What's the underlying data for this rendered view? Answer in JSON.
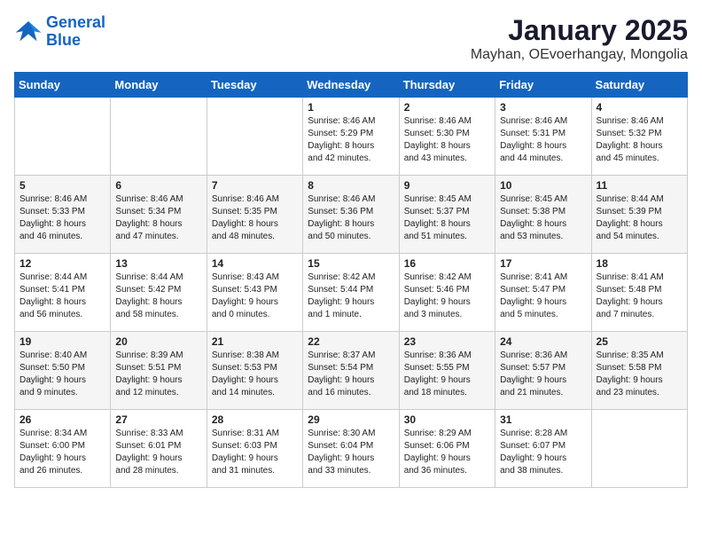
{
  "header": {
    "logo_line1": "General",
    "logo_line2": "Blue",
    "title": "January 2025",
    "subtitle": "Mayhan, OEvoerhangay, Mongolia"
  },
  "weekdays": [
    "Sunday",
    "Monday",
    "Tuesday",
    "Wednesday",
    "Thursday",
    "Friday",
    "Saturday"
  ],
  "weeks": [
    [
      {
        "day": "",
        "text": ""
      },
      {
        "day": "",
        "text": ""
      },
      {
        "day": "",
        "text": ""
      },
      {
        "day": "1",
        "text": "Sunrise: 8:46 AM\nSunset: 5:29 PM\nDaylight: 8 hours\nand 42 minutes."
      },
      {
        "day": "2",
        "text": "Sunrise: 8:46 AM\nSunset: 5:30 PM\nDaylight: 8 hours\nand 43 minutes."
      },
      {
        "day": "3",
        "text": "Sunrise: 8:46 AM\nSunset: 5:31 PM\nDaylight: 8 hours\nand 44 minutes."
      },
      {
        "day": "4",
        "text": "Sunrise: 8:46 AM\nSunset: 5:32 PM\nDaylight: 8 hours\nand 45 minutes."
      }
    ],
    [
      {
        "day": "5",
        "text": "Sunrise: 8:46 AM\nSunset: 5:33 PM\nDaylight: 8 hours\nand 46 minutes."
      },
      {
        "day": "6",
        "text": "Sunrise: 8:46 AM\nSunset: 5:34 PM\nDaylight: 8 hours\nand 47 minutes."
      },
      {
        "day": "7",
        "text": "Sunrise: 8:46 AM\nSunset: 5:35 PM\nDaylight: 8 hours\nand 48 minutes."
      },
      {
        "day": "8",
        "text": "Sunrise: 8:46 AM\nSunset: 5:36 PM\nDaylight: 8 hours\nand 50 minutes."
      },
      {
        "day": "9",
        "text": "Sunrise: 8:45 AM\nSunset: 5:37 PM\nDaylight: 8 hours\nand 51 minutes."
      },
      {
        "day": "10",
        "text": "Sunrise: 8:45 AM\nSunset: 5:38 PM\nDaylight: 8 hours\nand 53 minutes."
      },
      {
        "day": "11",
        "text": "Sunrise: 8:44 AM\nSunset: 5:39 PM\nDaylight: 8 hours\nand 54 minutes."
      }
    ],
    [
      {
        "day": "12",
        "text": "Sunrise: 8:44 AM\nSunset: 5:41 PM\nDaylight: 8 hours\nand 56 minutes."
      },
      {
        "day": "13",
        "text": "Sunrise: 8:44 AM\nSunset: 5:42 PM\nDaylight: 8 hours\nand 58 minutes."
      },
      {
        "day": "14",
        "text": "Sunrise: 8:43 AM\nSunset: 5:43 PM\nDaylight: 9 hours\nand 0 minutes."
      },
      {
        "day": "15",
        "text": "Sunrise: 8:42 AM\nSunset: 5:44 PM\nDaylight: 9 hours\nand 1 minute."
      },
      {
        "day": "16",
        "text": "Sunrise: 8:42 AM\nSunset: 5:46 PM\nDaylight: 9 hours\nand 3 minutes."
      },
      {
        "day": "17",
        "text": "Sunrise: 8:41 AM\nSunset: 5:47 PM\nDaylight: 9 hours\nand 5 minutes."
      },
      {
        "day": "18",
        "text": "Sunrise: 8:41 AM\nSunset: 5:48 PM\nDaylight: 9 hours\nand 7 minutes."
      }
    ],
    [
      {
        "day": "19",
        "text": "Sunrise: 8:40 AM\nSunset: 5:50 PM\nDaylight: 9 hours\nand 9 minutes."
      },
      {
        "day": "20",
        "text": "Sunrise: 8:39 AM\nSunset: 5:51 PM\nDaylight: 9 hours\nand 12 minutes."
      },
      {
        "day": "21",
        "text": "Sunrise: 8:38 AM\nSunset: 5:53 PM\nDaylight: 9 hours\nand 14 minutes."
      },
      {
        "day": "22",
        "text": "Sunrise: 8:37 AM\nSunset: 5:54 PM\nDaylight: 9 hours\nand 16 minutes."
      },
      {
        "day": "23",
        "text": "Sunrise: 8:36 AM\nSunset: 5:55 PM\nDaylight: 9 hours\nand 18 minutes."
      },
      {
        "day": "24",
        "text": "Sunrise: 8:36 AM\nSunset: 5:57 PM\nDaylight: 9 hours\nand 21 minutes."
      },
      {
        "day": "25",
        "text": "Sunrise: 8:35 AM\nSunset: 5:58 PM\nDaylight: 9 hours\nand 23 minutes."
      }
    ],
    [
      {
        "day": "26",
        "text": "Sunrise: 8:34 AM\nSunset: 6:00 PM\nDaylight: 9 hours\nand 26 minutes."
      },
      {
        "day": "27",
        "text": "Sunrise: 8:33 AM\nSunset: 6:01 PM\nDaylight: 9 hours\nand 28 minutes."
      },
      {
        "day": "28",
        "text": "Sunrise: 8:31 AM\nSunset: 6:03 PM\nDaylight: 9 hours\nand 31 minutes."
      },
      {
        "day": "29",
        "text": "Sunrise: 8:30 AM\nSunset: 6:04 PM\nDaylight: 9 hours\nand 33 minutes."
      },
      {
        "day": "30",
        "text": "Sunrise: 8:29 AM\nSunset: 6:06 PM\nDaylight: 9 hours\nand 36 minutes."
      },
      {
        "day": "31",
        "text": "Sunrise: 8:28 AM\nSunset: 6:07 PM\nDaylight: 9 hours\nand 38 minutes."
      },
      {
        "day": "",
        "text": ""
      }
    ]
  ]
}
